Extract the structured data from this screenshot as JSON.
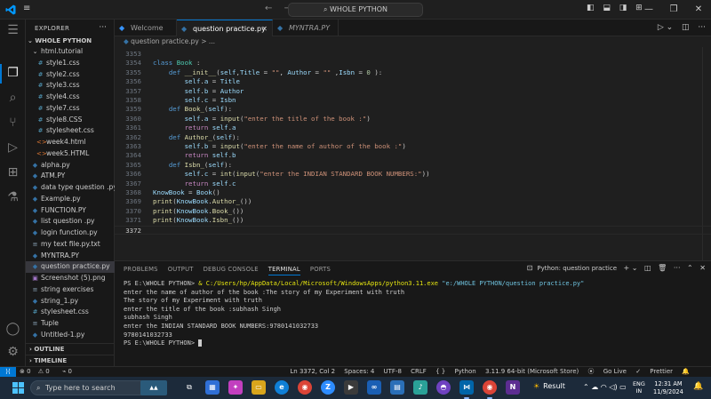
{
  "titlebar": {
    "search_text": "WHOLE PYTHON",
    "window_controls": [
      "—",
      "❐",
      "✕"
    ]
  },
  "sidebar": {
    "header": "EXPLORER",
    "root": "WHOLE PYTHON",
    "items": [
      {
        "label": "html.tutorial",
        "kind": "folder",
        "indent": 1
      },
      {
        "label": "style1.css",
        "kind": "css",
        "indent": 2
      },
      {
        "label": "style2.css",
        "kind": "css",
        "indent": 2
      },
      {
        "label": "style3.css",
        "kind": "css",
        "indent": 2
      },
      {
        "label": "style4.css",
        "kind": "css",
        "indent": 2
      },
      {
        "label": "style7.css",
        "kind": "css",
        "indent": 2
      },
      {
        "label": "style8.CSS",
        "kind": "css",
        "indent": 2
      },
      {
        "label": "stylesheet.css",
        "kind": "css",
        "indent": 2
      },
      {
        "label": "week4.html",
        "kind": "html",
        "indent": 2
      },
      {
        "label": "week5.HTML",
        "kind": "html",
        "indent": 2
      },
      {
        "label": "alpha.py",
        "kind": "py",
        "indent": 1
      },
      {
        "label": "ATM.PY",
        "kind": "py",
        "indent": 1
      },
      {
        "label": "data type question .py",
        "kind": "py",
        "indent": 1
      },
      {
        "label": "Example.py",
        "kind": "py",
        "indent": 1
      },
      {
        "label": "FUNCTION.PY",
        "kind": "py",
        "indent": 1
      },
      {
        "label": "list question .py",
        "kind": "py",
        "indent": 1
      },
      {
        "label": "login  function.py",
        "kind": "py",
        "indent": 1
      },
      {
        "label": "my text file.py.txt",
        "kind": "txt",
        "indent": 1
      },
      {
        "label": "MYNTRA.PY",
        "kind": "py",
        "indent": 1
      },
      {
        "label": "question practice.py",
        "kind": "py",
        "indent": 1,
        "selected": true
      },
      {
        "label": "Screenshot (5).png",
        "kind": "img",
        "indent": 1
      },
      {
        "label": "string exercises",
        "kind": "txt",
        "indent": 1
      },
      {
        "label": "string_1.py",
        "kind": "py",
        "indent": 1
      },
      {
        "label": "stylesheet.css",
        "kind": "css",
        "indent": 1
      },
      {
        "label": "Tuple",
        "kind": "txt",
        "indent": 1
      },
      {
        "label": "Untitled-1.py",
        "kind": "py",
        "indent": 1
      }
    ],
    "outline": "OUTLINE",
    "timeline": "TIMELINE"
  },
  "tabs": [
    {
      "label": "Welcome",
      "active": false
    },
    {
      "label": "question practice.py",
      "active": true
    },
    {
      "label": "MYNTRA.PY",
      "active": false
    }
  ],
  "breadcrumb": "question practice.py > ...",
  "editor": {
    "lines": [
      {
        "n": "3353",
        "text": ""
      },
      {
        "n": "3354",
        "text": "class Book :"
      },
      {
        "n": "3355",
        "text": "    def __init__(self,Title = \"\", Author = \"\" ,Isbn = 0 ):"
      },
      {
        "n": "3356",
        "text": "        self.a = Title"
      },
      {
        "n": "3357",
        "text": "        self.b = Author"
      },
      {
        "n": "3358",
        "text": "        self.c = Isbn"
      },
      {
        "n": "3359",
        "text": "    def Book_(self):"
      },
      {
        "n": "3360",
        "text": "        self.a = input(\"enter the title of the book :\")"
      },
      {
        "n": "3361",
        "text": "        return self.a"
      },
      {
        "n": "3362",
        "text": "    def Author_(self):"
      },
      {
        "n": "3363",
        "text": "        self.b = input(\"enter the name of author of the book :\")"
      },
      {
        "n": "3364",
        "text": "        return self.b"
      },
      {
        "n": "3365",
        "text": "    def Isbn_(self):"
      },
      {
        "n": "3366",
        "text": "        self.c = int(input(\"enter the INDIAN STANDARD BOOK NUMBERS:\"))"
      },
      {
        "n": "3367",
        "text": "        return self.c"
      },
      {
        "n": "3368",
        "text": "KnowBook = Book()"
      },
      {
        "n": "3369",
        "text": "print(KnowBook.Author_())"
      },
      {
        "n": "3370",
        "text": "print(KnowBook.Book_())"
      },
      {
        "n": "3371",
        "text": "print(KnowBook.Isbn_())"
      },
      {
        "n": "3372",
        "text": "",
        "current": true
      }
    ]
  },
  "panel": {
    "tabs": [
      "PROBLEMS",
      "OUTPUT",
      "DEBUG CONSOLE",
      "TERMINAL",
      "PORTS"
    ],
    "active_tab": "TERMINAL",
    "terminal_name": "Python: question practice",
    "terminal": {
      "prompt1": "PS E:\\WHOLE PYTHON> ",
      "cmd_amp": "& ",
      "cmd_exe": "C:/Users/hp/AppData/Local/Microsoft/WindowsApps/python3.11.exe",
      "cmd_arg": " \"e:/WHOLE PYTHON/question practice.py\"",
      "output": [
        "enter the name of author of the book :The story of my Experiment with truth",
        "The story of my Experiment with truth",
        "enter the title of the book :subhash Singh",
        "subhash Singh",
        "enter the INDIAN STANDARD BOOK NUMBERS:9780141032733",
        "9780141032733"
      ],
      "prompt2": "PS E:\\WHOLE PYTHON> "
    }
  },
  "statusbar": {
    "errors": "0",
    "warnings": "0",
    "ports": "0",
    "position": "Ln 3372, Col 2",
    "spaces": "Spaces: 4",
    "encoding": "UTF-8",
    "eol": "CRLF",
    "language": "Python",
    "interpreter": "3.11.9 64-bit (Microsoft Store)",
    "golive": "Go Live",
    "prettier": "Prettier"
  },
  "taskbar": {
    "search_placeholder": "Type here to search",
    "weather": "Result",
    "lang_top": "ENG",
    "lang_bottom": "IN",
    "time": "12:31 AM",
    "date": "11/9/2024"
  }
}
